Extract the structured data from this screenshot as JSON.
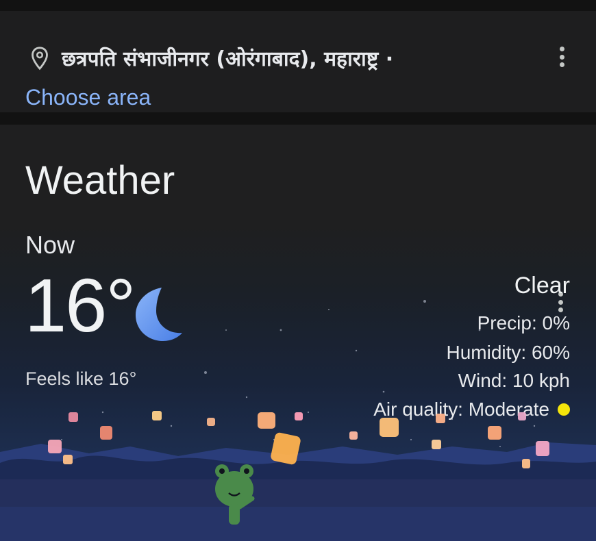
{
  "location_card": {
    "location_name": "छत्रपति संभाजीनगर (ओरंगाबाद), महाराष्ट्र ·",
    "choose_area_label": "Choose area",
    "icon": "location-pin-icon"
  },
  "weather_card": {
    "title": "Weather",
    "now_label": "Now",
    "temperature": "16°",
    "feels_like": "Feels like 16°",
    "condition": "Clear",
    "precip": "Precip: 0%",
    "humidity": "Humidity: 60%",
    "wind": "Wind: 10 kph",
    "air_quality": "Air quality: Moderate",
    "air_quality_color": "#f5e50b",
    "condition_icon": "moon-icon"
  },
  "colors": {
    "accent_link": "#8ab4f8",
    "card_bg": "#1e1e1f",
    "moon": "#6ea0f5"
  }
}
